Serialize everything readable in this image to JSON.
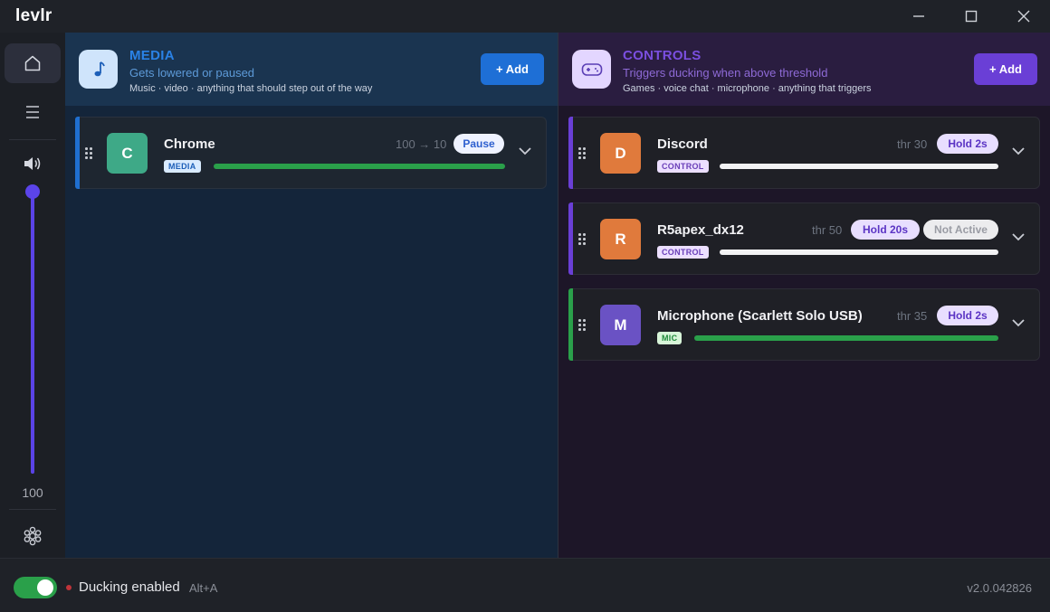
{
  "app": {
    "title": "levlr"
  },
  "sidebar": {
    "volume": "100",
    "volume_level": 1.0
  },
  "media_panel": {
    "title": "MEDIA",
    "subtitle": "Gets lowered or paused",
    "description": "Music · video · anything that should step out of the way",
    "add_label": "+ Add",
    "icon": "music-note-icon",
    "accent_color": "#1f6fd0",
    "items": [
      {
        "initial": "C",
        "name": "Chrome",
        "tag": "MEDIA",
        "ducking": "100 → 10",
        "action": "Pause",
        "avatar_color": "#3ea987",
        "level": 1.0
      }
    ]
  },
  "controls_panel": {
    "title": "CONTROLS",
    "subtitle": "Triggers ducking when above threshold",
    "description": "Games · voice chat · microphone · anything that triggers",
    "add_label": "+ Add",
    "icon": "gamepad-icon",
    "accent_color": "#6a3fd6",
    "items": [
      {
        "initial": "D",
        "name": "Discord",
        "tag": "CONTROL",
        "threshold": "thr 30",
        "hold": "Hold 2s",
        "avatar_color": "#e07a3c"
      },
      {
        "initial": "R",
        "name": "R5apex_dx12",
        "tag": "CONTROL",
        "threshold": "thr 50",
        "hold": "Hold 20s",
        "status": "Not Active",
        "avatar_color": "#e07a3c"
      },
      {
        "initial": "M",
        "name": "Microphone (Scarlett Solo USB)",
        "tag": "MIC",
        "threshold": "thr 35",
        "hold": "Hold 2s",
        "avatar_color": "#6a52c4"
      }
    ]
  },
  "footer": {
    "ducking_label": "Ducking enabled",
    "shortcut": "Alt+A",
    "version": "v2.0.042826",
    "toggle_on": true
  }
}
